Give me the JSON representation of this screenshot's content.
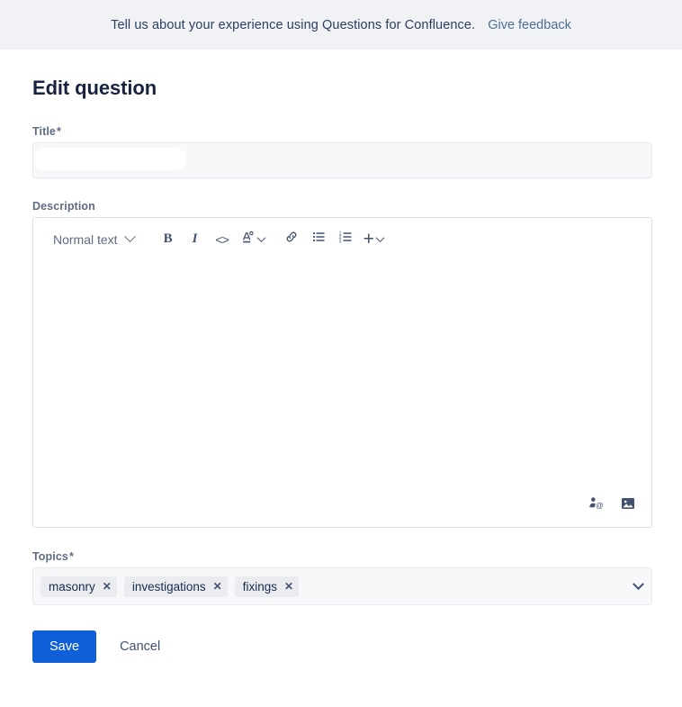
{
  "banner": {
    "message": "Tell us about your experience using Questions for Confluence.",
    "link_label": "Give feedback"
  },
  "page": {
    "title": "Edit question"
  },
  "title_field": {
    "label": "Title",
    "required_marker": "*",
    "value": "",
    "placeholder": ""
  },
  "description_field": {
    "label": "Description",
    "content": "",
    "toolbar": {
      "text_style_label": "Normal text",
      "bold_label": "B",
      "italic_label": "I",
      "code_label": "<>",
      "text_color_label": "A",
      "link_icon": "link-icon",
      "bullet_list_icon": "bullet-list-icon",
      "numbered_list_icon": "numbered-list-icon",
      "insert_label": "+"
    },
    "actions": {
      "mention_icon": "mention-icon",
      "image_icon": "image-icon"
    }
  },
  "topics_field": {
    "label": "Topics",
    "required_marker": "*",
    "tags": [
      {
        "label": "masonry",
        "remove": "✕"
      },
      {
        "label": "investigations",
        "remove": "✕"
      },
      {
        "label": "fixings",
        "remove": "✕"
      }
    ]
  },
  "footer": {
    "save_label": "Save",
    "cancel_label": "Cancel"
  },
  "colors": {
    "banner_bg": "#F1F2F6",
    "primary_button": "#0E5FD8",
    "link": "#4E6E8E",
    "heading_text": "#18233F",
    "label_text": "#5E6C84",
    "tag_bg": "#EBECF0",
    "field_bg": "#F7F8FA",
    "border": "#DFE1E6"
  }
}
